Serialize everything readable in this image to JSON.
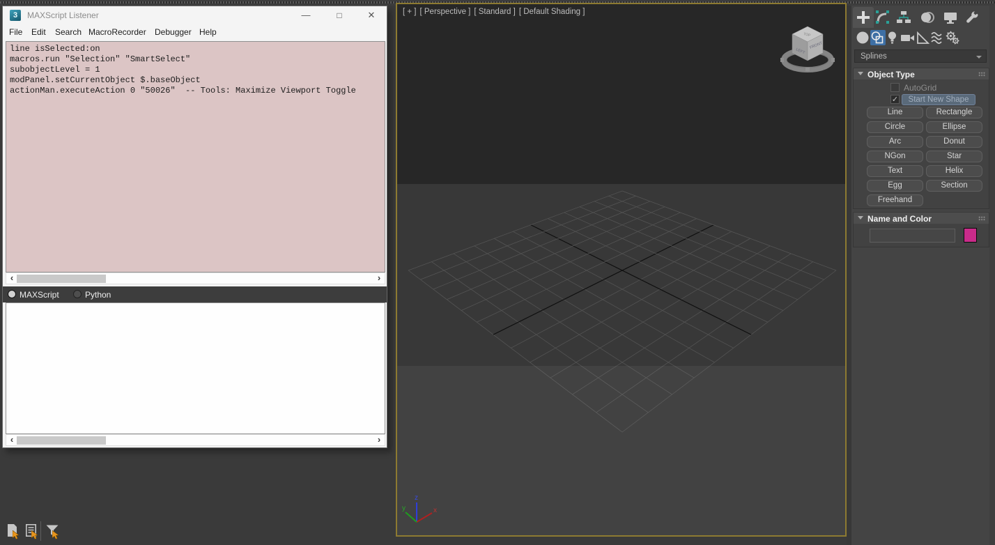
{
  "listener_window": {
    "title": "MAXScript Listener",
    "window_icon": "3",
    "controls": {
      "minimize": "—",
      "maximize": "□",
      "close": "✕"
    },
    "menus": [
      "File",
      "Edit",
      "Search",
      "MacroRecorder",
      "Debugger",
      "Help"
    ],
    "menu_lefts": [
      9,
      41,
      75,
      123,
      218,
      282
    ],
    "macro_pane": {
      "lines": [
        "line isSelected:on",
        "macros.run \"Selection\" \"SmartSelect\"",
        "subobjectLevel = 1",
        "modPanel.setCurrentObject $.baseObject",
        "actionMan.executeAction 0 \"50026\"  -- Tools: Maximize Viewport Toggle"
      ]
    },
    "language_tabs": [
      {
        "label": "MAXScript",
        "selected": true
      },
      {
        "label": "Python",
        "selected": false
      }
    ],
    "output_lines": []
  },
  "status_icons": [
    "new-script-icon",
    "listener-log-icon",
    "filter-icon"
  ],
  "viewport": {
    "labels": [
      "[ + ]",
      "[ Perspective ]",
      "[ Standard ]",
      "[ Default Shading ]"
    ],
    "border_color": "#8d7a31",
    "grid": {
      "extent": 6,
      "line_color": "#555555",
      "axis_color": "#0d0d0d"
    },
    "viewcube_faces": {
      "top": "TOP",
      "left": "LEFT",
      "right": "FRONT"
    },
    "axes": {
      "x": "x",
      "y": "y",
      "z": "z"
    }
  },
  "command_panel": {
    "tabs": [
      "create",
      "modify",
      "hierarchy",
      "motion",
      "display",
      "utilities"
    ],
    "active_tab": "create",
    "categories": [
      "geometry",
      "shapes",
      "lights",
      "cameras",
      "helpers",
      "space-warps",
      "systems"
    ],
    "active_category": "shapes",
    "dropdown_value": "Splines",
    "object_type": {
      "title": "Object Type",
      "autogrid_label": "AutoGrid",
      "start_new_shape_label": "Start New Shape",
      "start_new_shape_checked": true,
      "check_glyph": "✓",
      "buttons": [
        "Line",
        "Rectangle",
        "Circle",
        "Ellipse",
        "Arc",
        "Donut",
        "NGon",
        "Star",
        "Text",
        "Helix",
        "Egg",
        "Section",
        "Freehand"
      ]
    },
    "name_and_color": {
      "title": "Name and Color",
      "name_value": "",
      "color": "#ca2b8a"
    }
  }
}
